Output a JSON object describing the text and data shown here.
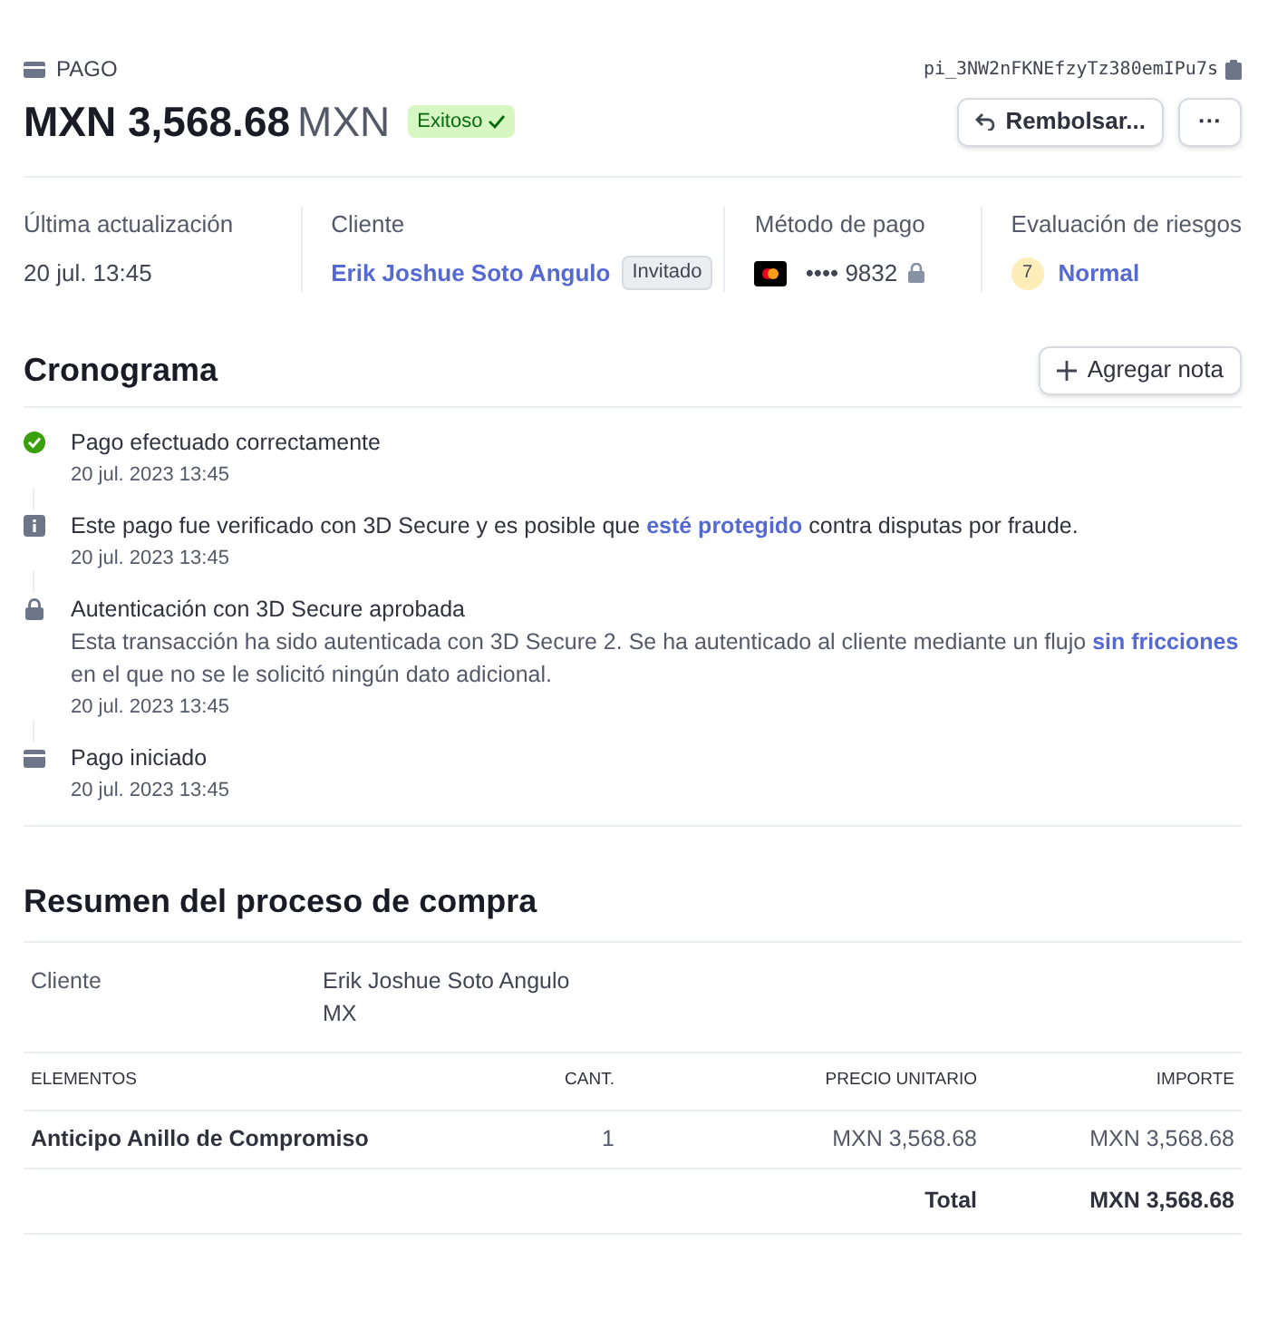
{
  "header": {
    "kind_label": "PAGO",
    "payment_id": "pi_3NW2nFKNEfzyTz380emIPu7s",
    "amount": "MXN 3,568.68",
    "currency": "MXN",
    "status": "Exitoso",
    "buttons": [
      "Rembolsar...",
      "···"
    ]
  },
  "summary": [
    {
      "kind": "text",
      "label": "Última actualización",
      "value": "20 jul. 13:45"
    },
    {
      "kind": "customer",
      "label": "Cliente",
      "value": "Erik Joshue Soto Angulo",
      "badge": "Invitado"
    },
    {
      "kind": "card",
      "label": "Método de pago",
      "value": "•••• 9832"
    },
    {
      "kind": "risk",
      "label": "Evaluación de riesgos",
      "score": "7",
      "value": "Normal"
    }
  ],
  "timeline": {
    "title": "Cronograma",
    "button": "Agregar nota",
    "events": [
      {
        "kind": "success",
        "title": [
          {
            "text": "Pago efectuado correctamente"
          }
        ],
        "date": "20 jul. 2023 13:45"
      },
      {
        "kind": "info",
        "title": [
          {
            "text": "Este pago fue verificado con 3D Secure y es posible que "
          },
          {
            "text": "esté protegido",
            "link": true
          },
          {
            "text": " contra disputas por fraude."
          }
        ],
        "date": "20 jul. 2023 13:45"
      },
      {
        "kind": "lock",
        "title": [
          {
            "text": "Autenticación con 3D Secure aprobada"
          }
        ],
        "detail": [
          {
            "text": "Esta transacción ha sido autenticada con 3D Secure 2. Se ha autenticado al cliente mediante un flujo "
          },
          {
            "text": "sin fricciones",
            "link": true
          },
          {
            "text": " en el que no se le solicitó ningún dato adicional."
          }
        ],
        "date": "20 jul. 2023 13:45"
      },
      {
        "kind": "payment",
        "title": [
          {
            "text": "Pago iniciado"
          }
        ],
        "date": "20 jul. 2023 13:45"
      }
    ]
  },
  "checkout": {
    "title": "Resumen del proceso de compra",
    "customer_label": "Cliente",
    "customer_lines": [
      "Erik Joshue Soto Angulo",
      "MX"
    ],
    "columns": [
      "ELEMENTOS",
      "CANT.",
      "PRECIO UNITARIO",
      "IMPORTE"
    ],
    "rows": [
      [
        "Anticipo Anillo de Compromiso",
        "1",
        "MXN 3,568.68",
        "MXN 3,568.68"
      ]
    ],
    "total_label": "Total",
    "total": "MXN 3,568.68"
  }
}
